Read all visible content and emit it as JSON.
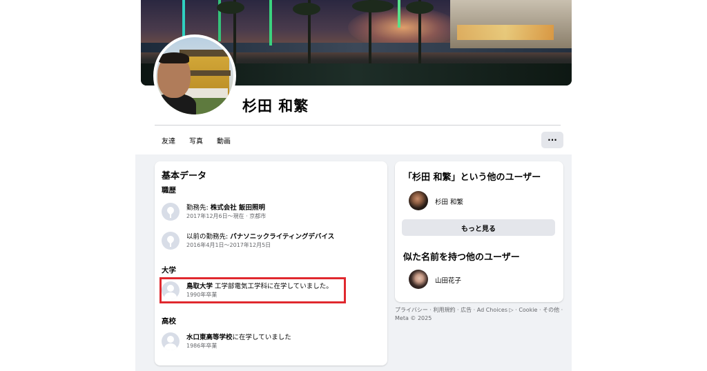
{
  "profile": {
    "name": "杉田 和繁"
  },
  "tabs": [
    "友達",
    "写真",
    "動画"
  ],
  "more_button": "···",
  "about": {
    "title": "基本データ",
    "work_title": "職歴",
    "work": [
      {
        "prefix": "勤務先: ",
        "org": "株式会社 飯田照明",
        "suffix": "",
        "detail": "2017年12月6日～現在 · 京都市"
      },
      {
        "prefix": "以前の勤務先: ",
        "org": "パナソニックライティングデバイス",
        "suffix": "",
        "detail": "2016年4月1日～2017年12月5日"
      }
    ],
    "university_title": "大学",
    "university": {
      "org": "鳥取大学",
      "suffix": " 工学部電気工学科に在学していました。",
      "detail": "1990年卒業"
    },
    "highschool_title": "高校",
    "highschool": {
      "org": "水口東高等学校",
      "suffix": "に在学していました",
      "detail": "1986年卒業"
    }
  },
  "others": {
    "same_name_title": "「杉田 和繁」という他のユーザー",
    "same_name_user": "杉田 和繁",
    "see_more": "もっと見る",
    "similar_title": "似た名前を持つ他のユーザー",
    "similar_user": "山田花子"
  },
  "footer": {
    "links": [
      "プライバシー",
      "利用規約",
      "広告",
      "Ad Choices ▷",
      "Cookie",
      "その他"
    ],
    "separator": " · ",
    "copyright": "Meta © 2025"
  },
  "colors": {
    "highlight": "#e0282e",
    "page_bg": "#f0f2f5",
    "button_bg": "#e4e6eb"
  }
}
